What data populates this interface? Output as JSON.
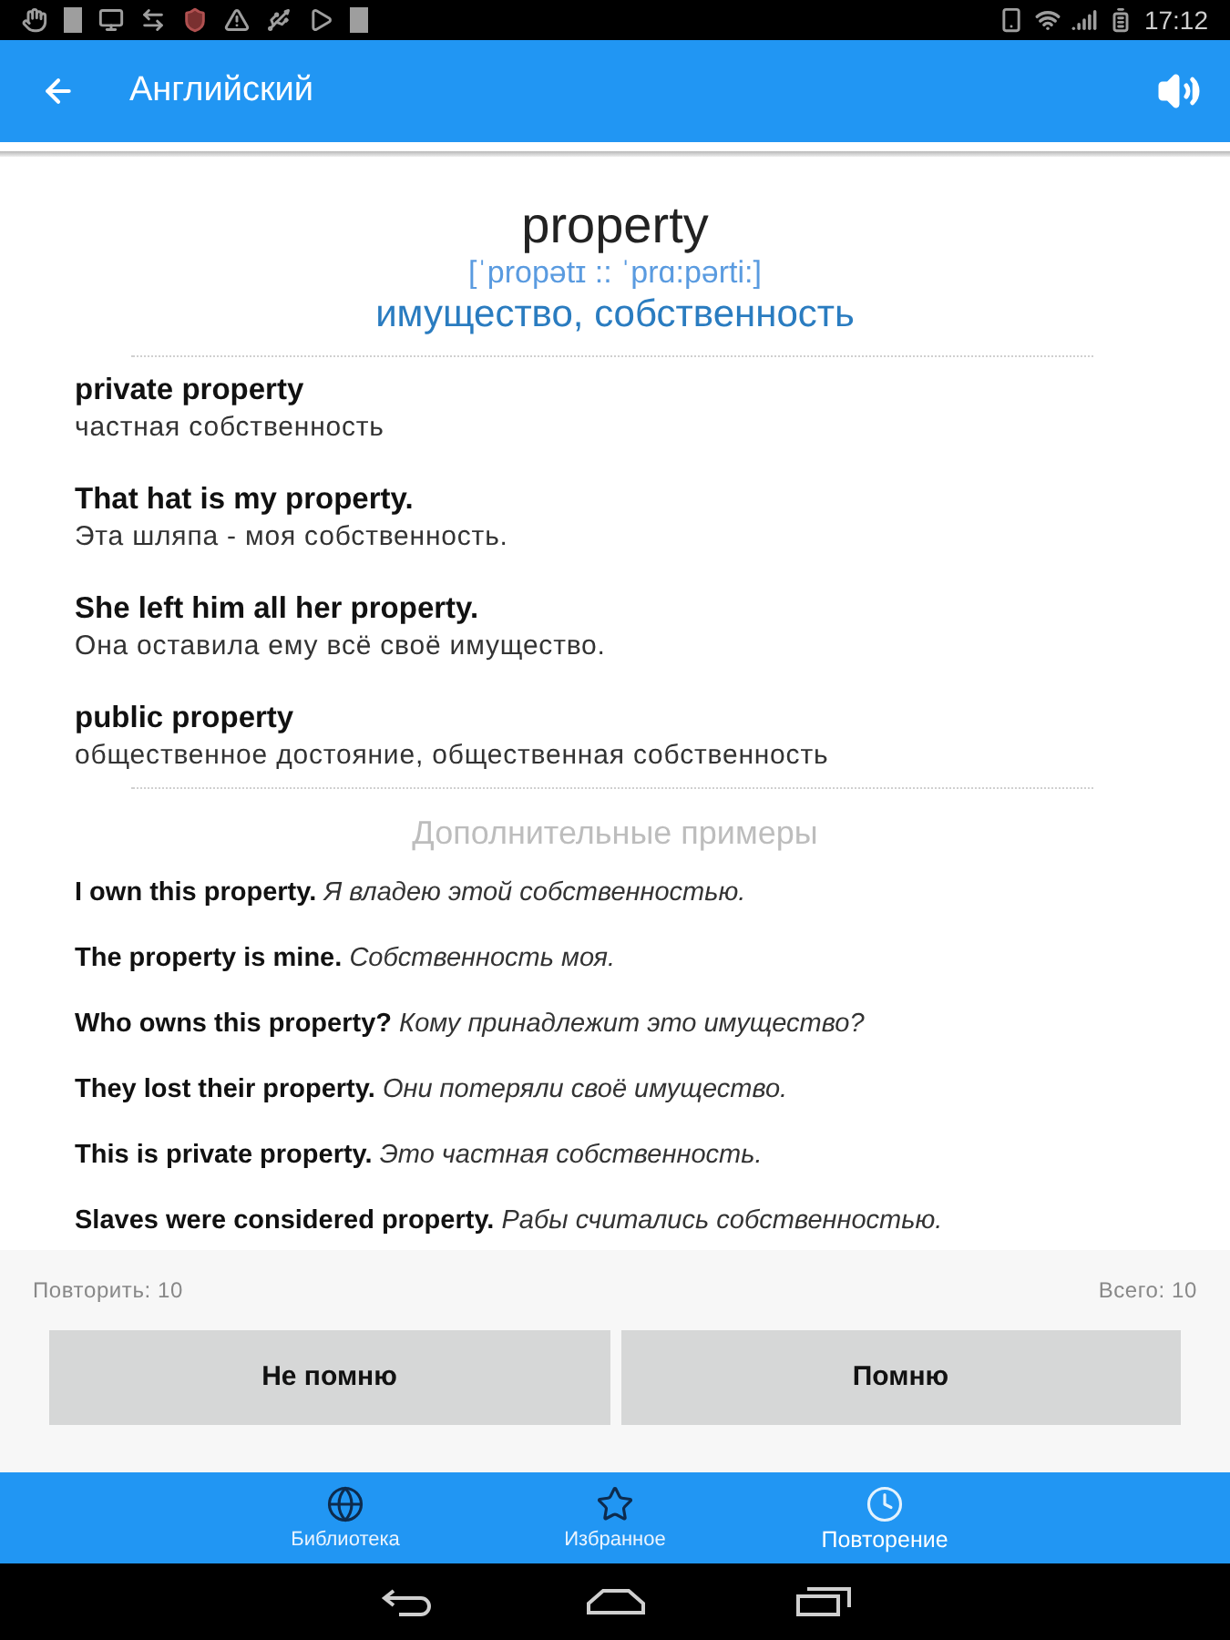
{
  "status_bar": {
    "time": "17:12"
  },
  "app_bar": {
    "title": "Английский"
  },
  "word": {
    "headword": "property",
    "transcription": "[ˈpropətɪ :: ˈprɑ:pərti:]",
    "translation": "имущество, собственность"
  },
  "phrases": [
    {
      "text": "private property",
      "translation": "частная собственность"
    },
    {
      "text": "That hat is my property.",
      "translation": "Эта шляпа - моя собственность."
    },
    {
      "text": "She left him all her property.",
      "translation": "Она оставила ему всё своё имущество."
    },
    {
      "text": "public property",
      "translation": "общественное достояние, общественная собственность"
    }
  ],
  "more_examples": {
    "heading": "Дополнительные примеры",
    "items": [
      {
        "text": "I own this property.",
        "translation": "Я владею этой собственностью."
      },
      {
        "text": "The property is mine.",
        "translation": "Собственность моя."
      },
      {
        "text": "Who owns this property?",
        "translation": "Кому принадлежит это имущество?"
      },
      {
        "text": "They lost their property.",
        "translation": "Они потеряли своё имущество."
      },
      {
        "text": "This is private property.",
        "translation": "Это частная собственность."
      },
      {
        "text": "Slaves were considered property.",
        "translation": "Рабы считались собственностью."
      }
    ]
  },
  "review": {
    "repeat_count": "Повторить: 10",
    "total": "Всего: 10",
    "buttons": [
      "Не помню",
      "Помню"
    ]
  },
  "bottom_nav": [
    {
      "label": "Библиотека",
      "selected": false
    },
    {
      "label": "Избранное",
      "selected": false
    },
    {
      "label": "Повторение",
      "selected": true
    }
  ]
}
